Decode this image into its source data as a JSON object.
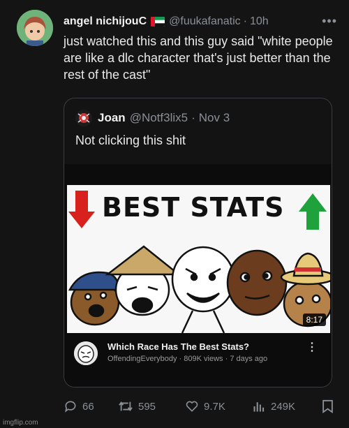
{
  "tweet": {
    "display_name": "angel nichijouC",
    "handle": "@fuukafanatic",
    "separator": "·",
    "time": "10h",
    "more_label": "•••",
    "text": "just watched this and this guy said \"white people are like a dlc character that's just better than the rest of the cast\""
  },
  "quote": {
    "display_name": "Joan",
    "handle": "@Notf3lix5",
    "separator": "·",
    "date": "Nov 3",
    "text": "Not clicking this shit"
  },
  "youtube_card": {
    "thumbnail_title": "BEST STATS",
    "duration": "8:17",
    "video_title": "Which Race Has The Best Stats?",
    "channel": "OffendingEverybody",
    "views": "809K views",
    "age": "7 days ago",
    "menu_label": "⋮"
  },
  "actions": {
    "replies": "66",
    "reposts": "595",
    "likes": "9.7K",
    "views": "249K"
  },
  "watermark": "imgflip.com",
  "colors": {
    "background": "#141414",
    "text_muted": "#8b9096",
    "arrow_down": "#d8201c",
    "arrow_up": "#1fa13b"
  }
}
